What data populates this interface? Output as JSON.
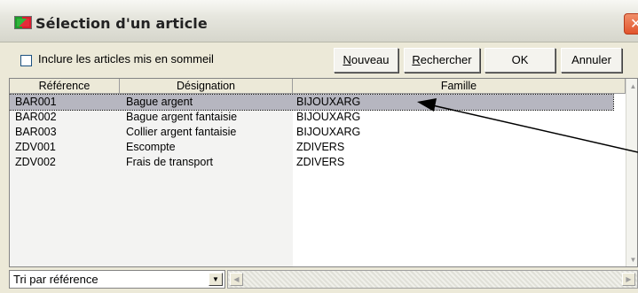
{
  "window": {
    "title": "Sélection d'un article",
    "close_glyph": "✕"
  },
  "toolbar": {
    "include_sleeping_label": "Inclure les articles mis en sommeil",
    "include_sleeping_checked": false,
    "new_label_u": "N",
    "new_label_rest": "ouveau",
    "search_label_u": "R",
    "search_label_rest": "echercher",
    "ok_label": "OK",
    "cancel_label": "Annuler"
  },
  "table": {
    "columns": [
      "Référence",
      "Désignation",
      "Famille"
    ],
    "rows": [
      {
        "reference": "BAR001",
        "designation": "Bague argent",
        "famille": "BIJOUXARG",
        "selected": true
      },
      {
        "reference": "BAR002",
        "designation": "Bague argent fantaisie",
        "famille": "BIJOUXARG",
        "selected": false
      },
      {
        "reference": "BAR003",
        "designation": "Collier argent fantaisie",
        "famille": "BIJOUXARG",
        "selected": false
      },
      {
        "reference": "ZDV001",
        "designation": "Escompte",
        "famille": "ZDIVERS",
        "selected": false
      },
      {
        "reference": "ZDV002",
        "designation": "Frais de transport",
        "famille": "ZDIVERS",
        "selected": false
      }
    ]
  },
  "sort": {
    "selected": "Tri par référence"
  },
  "icons": {
    "app": "app-flag-icon",
    "close": "close-icon",
    "dropdown": "chevron-down-icon",
    "scroll_up": "scroll-up-icon",
    "scroll_down": "scroll-down-icon",
    "scroll_left": "scroll-left-icon",
    "scroll_right": "scroll-right-icon"
  },
  "colors": {
    "selection": "#b6b6c0",
    "window_bg": "#ece9d8",
    "close_button": "#e1542d"
  }
}
